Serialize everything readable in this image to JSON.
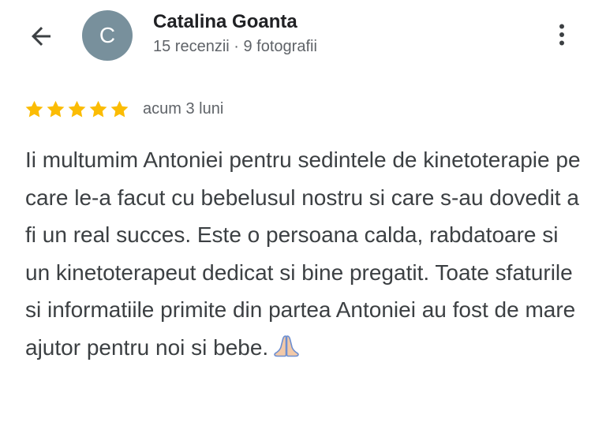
{
  "header": {
    "back_icon": "arrow-back-icon",
    "avatar_letter": "C",
    "avatar_color": "#78909c",
    "reviewer_name": "Catalina Goanta",
    "reviewer_stats": "15 recenzii · 9 fotografii",
    "more_icon": "more-vert-icon"
  },
  "review": {
    "rating": 5,
    "max_rating": 5,
    "star_color": "#fbbc04",
    "date": "acum 3 luni",
    "text": "Ii multumim Antoniei pentru sedintele de kinetoterapie pe care le-a facut cu bebelusul nostru si care s-au dovedit a fi un real succes. Este o persoana calda, rabdatoare si un kinetoterapeut dedicat si bine pregatit. Toate sfaturile si informatiile primite din partea Antoniei au fost de mare ajutor pentru noi si bebe.",
    "emoji_icon": "folded-hands-icon"
  }
}
